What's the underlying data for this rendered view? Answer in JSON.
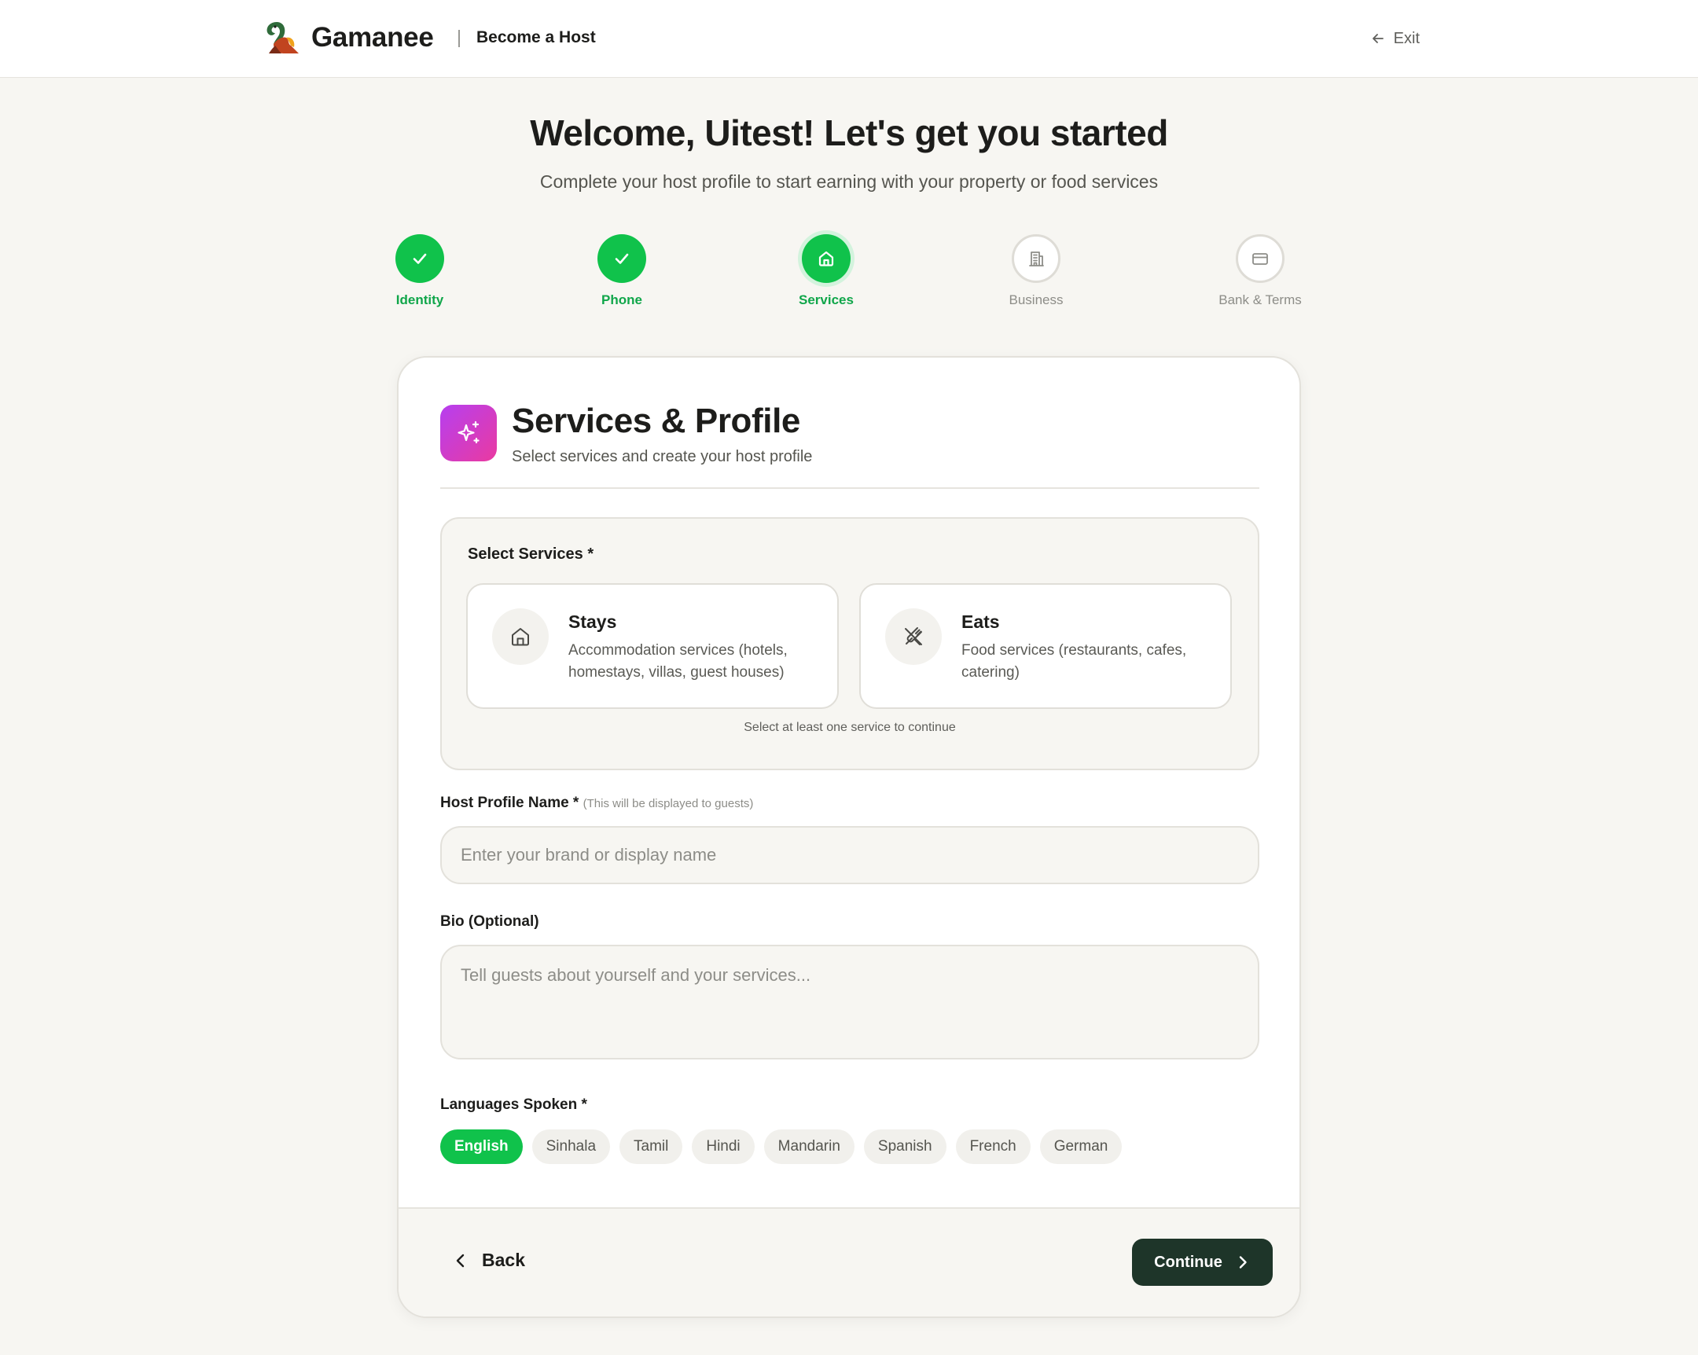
{
  "header": {
    "brand": "Gamanee",
    "section": "Become a Host",
    "exit_label": "Exit"
  },
  "intro": {
    "title": "Welcome, Uitest! Let's get you started",
    "subtitle": "Complete your host profile to start earning with your property or food services"
  },
  "stepper": [
    {
      "label": "Identity",
      "status": "done",
      "icon": "check-icon"
    },
    {
      "label": "Phone",
      "status": "done",
      "icon": "check-icon"
    },
    {
      "label": "Services",
      "status": "current",
      "icon": "home-icon"
    },
    {
      "label": "Business",
      "status": "todo",
      "icon": "building-icon"
    },
    {
      "label": "Bank & Terms",
      "status": "todo",
      "icon": "credit-card-icon"
    }
  ],
  "section": {
    "title": "Services & Profile",
    "subtitle": "Select services and create your host profile",
    "icon": "sparkles-icon"
  },
  "services": {
    "label": "Select Services *",
    "items": [
      {
        "name": "Stays",
        "description": "Accommodation services (hotels, homestays, villas, guest houses)",
        "icon": "home-icon"
      },
      {
        "name": "Eats",
        "description": "Food services (restaurants, cafes, catering)",
        "icon": "utensils-crossed-icon"
      }
    ],
    "hint": "Select at least one service to continue"
  },
  "profile_name": {
    "label": "Host Profile Name *",
    "note": "(This will be displayed to guests)",
    "placeholder": "Enter your brand or display name",
    "value": ""
  },
  "bio": {
    "label": "Bio (Optional)",
    "placeholder": "Tell guests about yourself and your services...",
    "value": ""
  },
  "languages": {
    "label": "Languages Spoken *",
    "options": [
      "English",
      "Sinhala",
      "Tamil",
      "Hindi",
      "Mandarin",
      "Spanish",
      "French",
      "German"
    ],
    "selected": [
      "English"
    ]
  },
  "footer": {
    "back_label": "Back",
    "continue_label": "Continue"
  },
  "colors": {
    "accent_green": "#10c24b",
    "primary_dark": "#1e3529",
    "section_gradient_start": "#b63ff0",
    "section_gradient_end": "#ea3aa0",
    "background": "#f7f6f2"
  }
}
